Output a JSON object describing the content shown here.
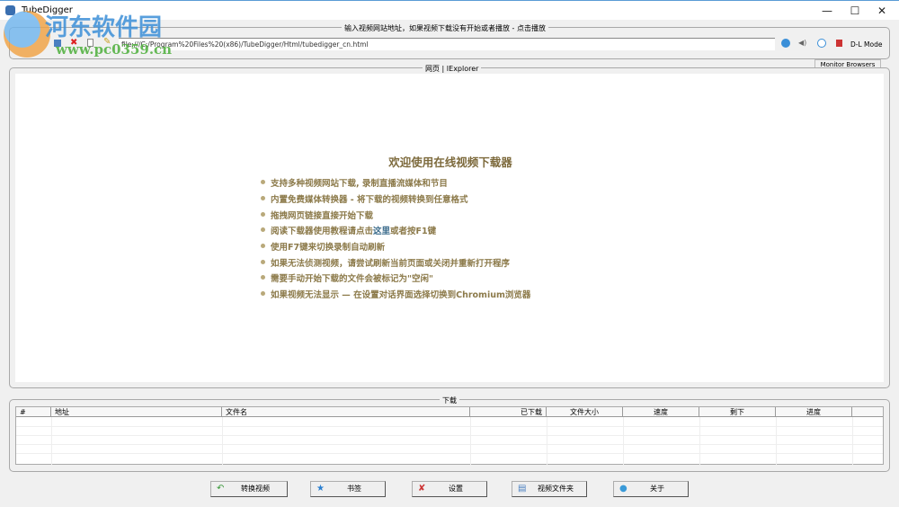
{
  "window": {
    "title": "TubeDigger",
    "minimize": "—",
    "maximize": "☐",
    "close": "✕"
  },
  "url_group": {
    "legend": "输入视频网站地址，如果视频下载没有开始或者播放 - 点击播放",
    "url": "file:///C:/Program%20Files%20(x86)/TubeDigger/Html/tubedigger_cn.html",
    "dl_mode": "D-L Mode",
    "monitor_browsers": "Monitor Browsers"
  },
  "browser": {
    "legend": "网页 | IExplorer",
    "title": "欢迎使用在线视频下载器",
    "bullets": [
      "支持多种视频网站下载, 录制直播流媒体和节目",
      "内置免费媒体转换器 - 将下载的视频转换到任意格式",
      "拖拽网页链接直接开始下载",
      "阅读下载器使用教程请点击",
      "使用F7键来切换录制自动刷新",
      "如果无法侦测视频，请尝试刷新当前页面或关闭并重新打开程序",
      "需要手动开始下载的文件会被标记为\"空闲\"",
      "如果视频无法显示 — 在设置对话界面选择切换到Chromium浏览器"
    ],
    "link_text": "这里",
    "after_link": "或者按F1键"
  },
  "downloads": {
    "legend": "下载",
    "columns": [
      "#",
      "地址",
      "文件名",
      "已下载",
      "文件大小",
      "速度",
      "剩下",
      "进度"
    ]
  },
  "buttons": [
    "转换视频",
    "书签",
    "设置",
    "视频文件夹",
    "关于"
  ],
  "watermark": {
    "name": "河东软件园",
    "url": "www.pc0359.cn"
  }
}
